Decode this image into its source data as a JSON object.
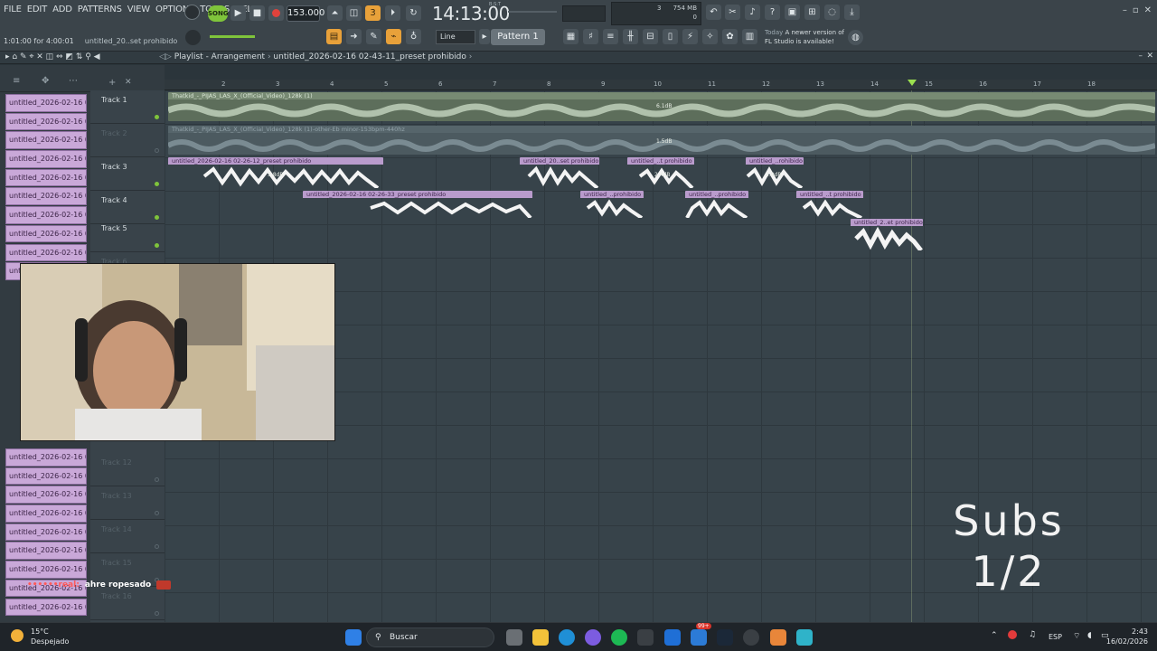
{
  "menu": [
    "FILE",
    "EDIT",
    "ADD",
    "PATTERNS",
    "VIEW",
    "OPTIONS",
    "TOOLS",
    "HELP"
  ],
  "transport": {
    "song_label": "SONG",
    "tempo": "153.000",
    "time": "14:13:00",
    "time_sub": "B:S:T"
  },
  "hint": {
    "time_range": "1:01:00 for 4:00:01",
    "project": "untitled_20..set prohibido"
  },
  "cpu": {
    "memory": "754 MB",
    "voices": "3",
    "polyphony": "0"
  },
  "pattern": {
    "label": "Pattern 1",
    "snap": "Line"
  },
  "news": {
    "date": "Today",
    "text": "A newer version of FL Studio is available!"
  },
  "playlist": {
    "title": "Playlist - Arrangement",
    "project": "untitled_2026-02-16 02-43-11_preset prohibido"
  },
  "browser": {
    "items": [
      "untitled_2026-02-16 02-",
      "untitled_2026-02-16 02-",
      "untitled_2026-02-16 02-",
      "untitled_2026-02-16 02-",
      "untitled_2026-02-16 02-",
      "untitled_2026-02-16 02-",
      "untitled_2026-02-16 02-",
      "untitled_2026-02-16 02-",
      "untitled_2026-02-16 02-",
      "untitled_2026-02-16 02-"
    ],
    "items_bottom": [
      "untitled_2026-02-16 02-",
      "untitled_2026-02-16 02-",
      "untitled_2026-02-16 02-",
      "untitled_2026-02-16 02-",
      "untitled_2026-02-16 02-",
      "untitled_2026-02-16 02-",
      "untitled_2026-02-16 02-",
      "untitled_2026-02-16 02-",
      "untitled_2026-02-16 02-"
    ]
  },
  "tracks": [
    "Track 1",
    "Track 2",
    "Track 3",
    "Track 4",
    "Track 5",
    "Track 6",
    "Track 12",
    "Track 13",
    "Track 14",
    "Track 15",
    "Track 16"
  ],
  "ruler": [
    "2",
    "3",
    "4",
    "5",
    "6",
    "7",
    "8",
    "9",
    "10",
    "11",
    "12",
    "13",
    "14",
    "15",
    "16",
    "17",
    "18"
  ],
  "clips": {
    "t1": {
      "title": "Thatkid_-_PIJAS_LAS_X_(Official_Video)_128k (1)",
      "db": "6.1dB"
    },
    "t2": {
      "title": "Thatkid_-_PIJAS_LAS_X_(Official_Video)_128k (1)-other-Eb minor-153bpm-440hz",
      "db": "1.5dB"
    },
    "t3a": {
      "title": "untitled_2026-02-16 02-26-12_preset prohibido",
      "db": "3.8dB"
    },
    "t3b": {
      "title": "untitled_20..set prohibido"
    },
    "t3c": {
      "title": "untitled_..t prohibido",
      "db": "2.4dB"
    },
    "t3d": {
      "title": "untitled_..rohibido",
      "db": "2.9dB"
    },
    "t4a": {
      "title": "untitled_2026-02-16 02-26-33_preset prohibido"
    },
    "t4b": {
      "title": "untitled_..prohibido"
    },
    "t4c": {
      "title": "untitled_..prohibido"
    },
    "t4d": {
      "title": "untitled_..t prohibido"
    },
    "t5a": {
      "title": "untitled_2..et prohibido"
    }
  },
  "overlay": {
    "subs_line1": "Subs",
    "subs_line2": "1/2"
  },
  "chat": {
    "user": "••••••real:",
    "message": "ahre ropesado"
  },
  "taskbar": {
    "temp": "15°C",
    "condition": "Despejado",
    "search": "Buscar",
    "lang": "ESP",
    "time": "2:43",
    "date": "16/02/2026",
    "badge": "99+"
  },
  "colors": {
    "accent_green": "#7fc43b",
    "clip_purple": "#b99bcc",
    "record_red": "#e0423c"
  }
}
